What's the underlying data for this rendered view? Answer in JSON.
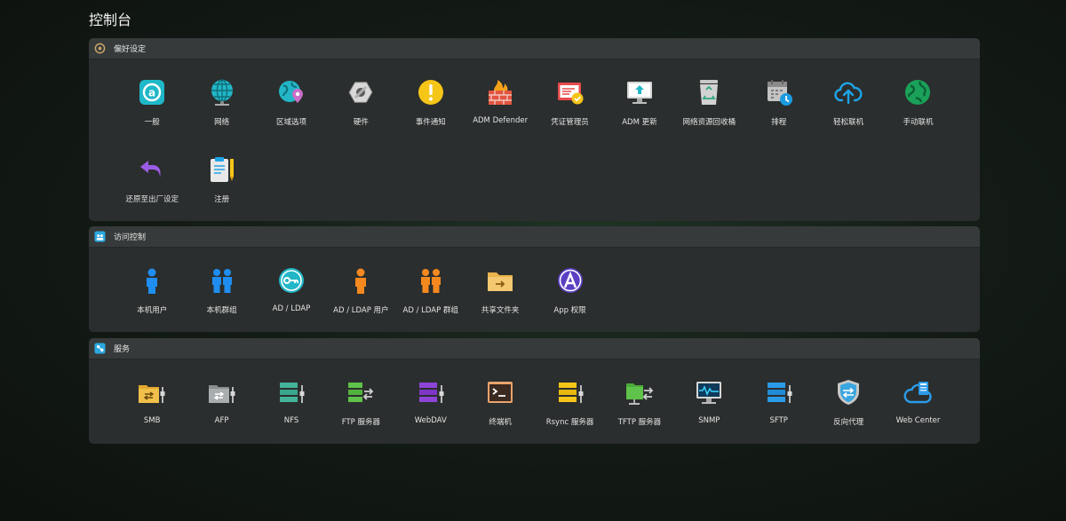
{
  "page": {
    "title": "控制台"
  },
  "sections": [
    {
      "title": "偏好设定",
      "icon": "gear-icon",
      "items": [
        {
          "label": "一般",
          "icon": "general-icon"
        },
        {
          "label": "网络",
          "icon": "globe-network-icon"
        },
        {
          "label": "区域选项",
          "icon": "region-globe-pin-icon"
        },
        {
          "label": "硬件",
          "icon": "hardware-nut-icon"
        },
        {
          "label": "事件通知",
          "icon": "notification-alert-icon"
        },
        {
          "label": "ADM Defender",
          "icon": "firewall-icon"
        },
        {
          "label": "凭证管理员",
          "icon": "certificate-icon"
        },
        {
          "label": "ADM 更新",
          "icon": "update-monitor-icon"
        },
        {
          "label": "网络资源回收桶",
          "icon": "recycle-bin-icon"
        },
        {
          "label": "排程",
          "icon": "calendar-clock-icon"
        },
        {
          "label": "轻松联机",
          "icon": "cloud-upload-icon"
        },
        {
          "label": "手动联机",
          "icon": "globe-manual-icon"
        },
        {
          "label": "还原至出厂设定",
          "icon": "undo-arrow-icon"
        },
        {
          "label": "注册",
          "icon": "register-clipboard-icon"
        }
      ]
    },
    {
      "title": "访问控制",
      "icon": "access-control-icon",
      "items": [
        {
          "label": "本机用户",
          "icon": "user-icon"
        },
        {
          "label": "本机群组",
          "icon": "group-icon"
        },
        {
          "label": "AD / LDAP",
          "icon": "key-icon"
        },
        {
          "label": "AD / LDAP 用户",
          "icon": "ldap-user-icon"
        },
        {
          "label": "AD / LDAP 群组",
          "icon": "ldap-group-icon"
        },
        {
          "label": "共享文件夹",
          "icon": "shared-folder-icon"
        },
        {
          "label": "App 权限",
          "icon": "app-permission-icon"
        }
      ]
    },
    {
      "title": "服务",
      "icon": "services-icon",
      "items": [
        {
          "label": "SMB",
          "icon": "smb-folder-icon"
        },
        {
          "label": "AFP",
          "icon": "afp-folder-icon"
        },
        {
          "label": "NFS",
          "icon": "nfs-server-icon"
        },
        {
          "label": "FTP 服务器",
          "icon": "ftp-server-icon"
        },
        {
          "label": "WebDAV",
          "icon": "webdav-server-icon"
        },
        {
          "label": "终端机",
          "icon": "terminal-icon"
        },
        {
          "label": "Rsync 服务器",
          "icon": "rsync-server-icon"
        },
        {
          "label": "TFTP 服务器",
          "icon": "tftp-folder-icon"
        },
        {
          "label": "SNMP",
          "icon": "snmp-monitor-icon"
        },
        {
          "label": "SFTP",
          "icon": "sftp-server-icon"
        },
        {
          "label": "反向代理",
          "icon": "reverse-proxy-shield-icon"
        },
        {
          "label": "Web Center",
          "icon": "web-center-cloud-icon"
        }
      ]
    }
  ]
}
